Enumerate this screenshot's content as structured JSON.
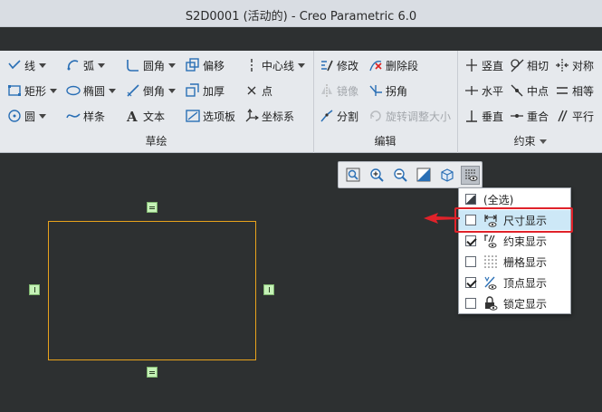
{
  "window": {
    "title": "S2D0001 (活动的) - Creo Parametric 6.0"
  },
  "ribbon": {
    "sketch": {
      "label": "草绘",
      "line": "线",
      "arc": "弧",
      "rectangle": "矩形",
      "ellipse": "椭圆",
      "circle": "圆",
      "spline": "样条",
      "fillet": "圆角",
      "chamfer": "倒角",
      "text": "文本",
      "offset": "偏移",
      "thicken": "加厚",
      "palette": "选项板",
      "centerline": "中心线",
      "point": "点",
      "coord_sys": "坐标系"
    },
    "edit": {
      "label": "编辑",
      "modify": "修改",
      "delete_segment": "删除段",
      "mirror": "镜像",
      "corner": "拐角",
      "divide": "分割",
      "rotate_resize": "旋转调整大小"
    },
    "constraint": {
      "label": "约束",
      "vertical": "竖直",
      "tangent": "相切",
      "symmetric": "对称",
      "horizontal": "水平",
      "midpoint": "中点",
      "equal": "相等",
      "perpendicular": "垂直",
      "coincident": "重合",
      "parallel": "平行"
    }
  },
  "view_toolbar": {
    "buttons": [
      "refit-icon",
      "zoom-in-icon",
      "zoom-out-icon",
      "repaint-icon",
      "view-orientation-icon",
      "sketcher-display-filter-icon"
    ]
  },
  "display_menu": {
    "items": [
      {
        "label": "(全选)",
        "checked": "partial"
      },
      {
        "label": "尺寸显示",
        "checked": false,
        "highlighted": true
      },
      {
        "label": "约束显示",
        "checked": true
      },
      {
        "label": "栅格显示",
        "checked": false
      },
      {
        "label": "顶点显示",
        "checked": true
      },
      {
        "label": "锁定显示",
        "checked": false
      }
    ]
  },
  "colors": {
    "canvas_bg": "#2d3031",
    "sketch_line": "#e8a21c",
    "constraint_glyph": "#c5f2b7",
    "highlight_box": "#e0222a",
    "menu_highlight": "#cde8f7"
  }
}
